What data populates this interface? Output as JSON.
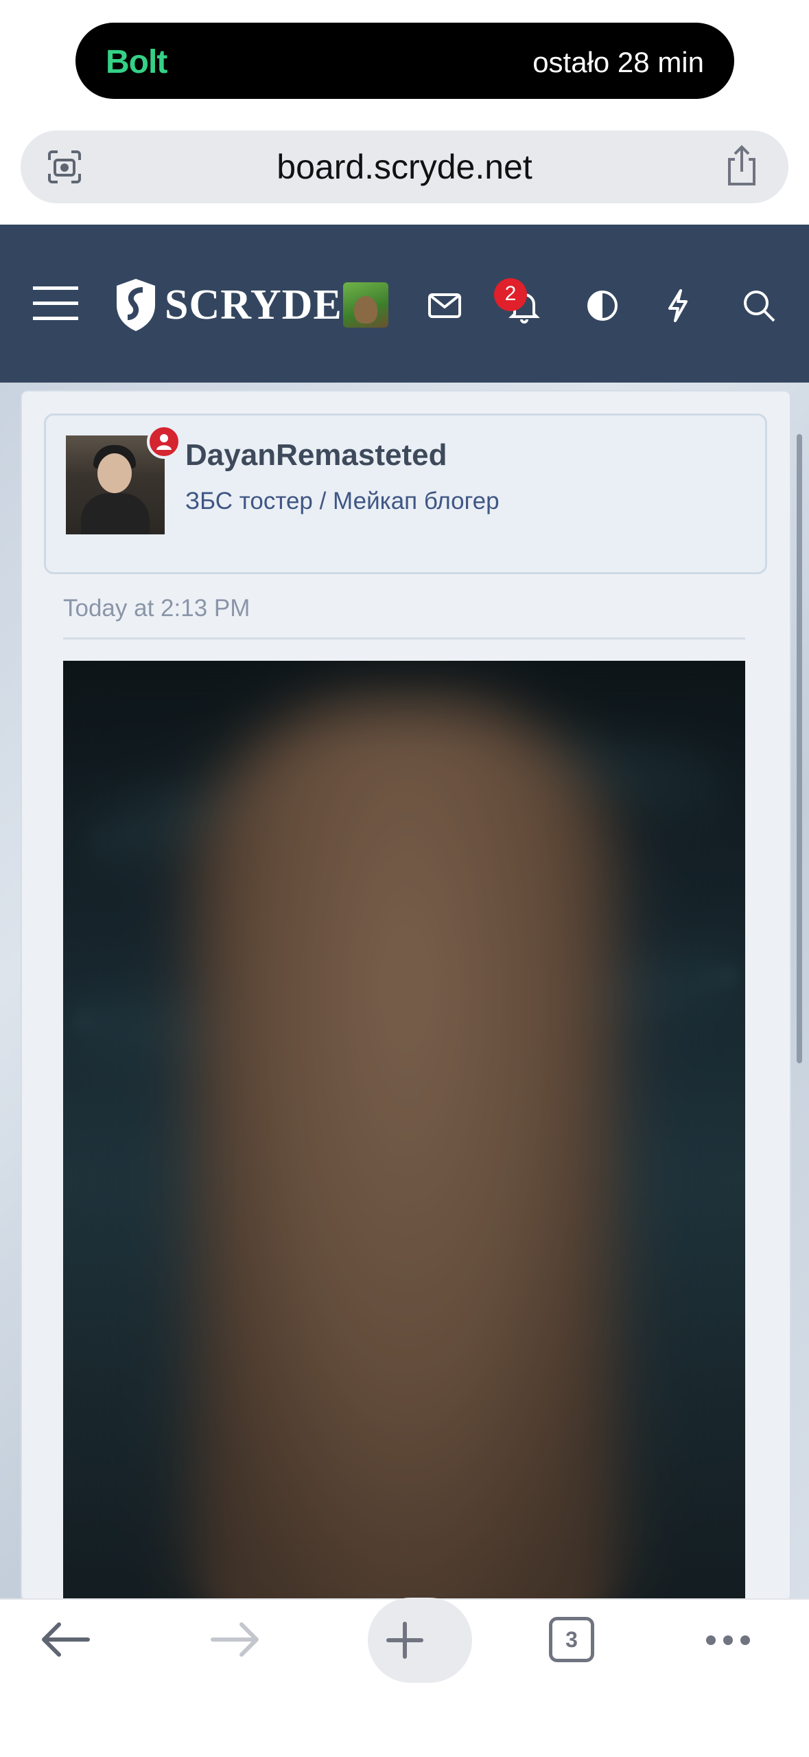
{
  "live_activity": {
    "app": "Bolt",
    "status": "ostało 28 min"
  },
  "browser": {
    "url": "board.scryde.net",
    "tabs_count": "3"
  },
  "site": {
    "logo_text": "SCRYDE",
    "notifications_count": "2"
  },
  "post": {
    "author": "DayanRemasteted",
    "author_title": "ЗБС тостер / Мейкап блогер",
    "timestamp": "Today at 2:13 PM"
  },
  "colors": {
    "header": "#34465f",
    "brand_green": "#34d186",
    "badge_red": "#e0202a"
  }
}
